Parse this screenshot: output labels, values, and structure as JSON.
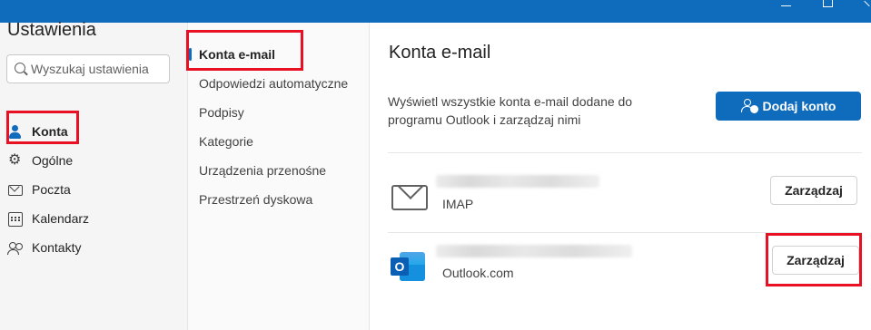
{
  "settings_nav": {
    "title": "Ustawienia",
    "search_placeholder": "Wyszukaj ustawienia",
    "items": [
      {
        "label": "Konta",
        "icon": "person-icon",
        "active": true
      },
      {
        "label": "Ogólne",
        "icon": "gear-icon"
      },
      {
        "label": "Poczta",
        "icon": "mail-icon"
      },
      {
        "label": "Kalendarz",
        "icon": "calendar-icon"
      },
      {
        "label": "Kontakty",
        "icon": "people-icon"
      }
    ]
  },
  "accounts_nav": {
    "items": [
      {
        "label": "Konta e-mail",
        "active": true
      },
      {
        "label": "Odpowiedzi automatyczne"
      },
      {
        "label": "Podpisy"
      },
      {
        "label": "Kategorie"
      },
      {
        "label": "Urządzenia przenośne"
      },
      {
        "label": "Przestrzeń dyskowa"
      }
    ]
  },
  "main": {
    "title": "Konta e-mail",
    "description": "Wyświetl wszystkie konta e-mail dodane do programu Outlook i zarządzaj nimi",
    "add_button": "Dodaj konto",
    "accounts": [
      {
        "type": "IMAP",
        "icon": "envelope-icon",
        "manage_label": "Zarządzaj"
      },
      {
        "type": "Outlook.com",
        "icon": "outlook-icon",
        "manage_label": "Zarządzaj"
      }
    ]
  },
  "colors": {
    "accent": "#0f6cbd",
    "highlight": "#e81123"
  }
}
